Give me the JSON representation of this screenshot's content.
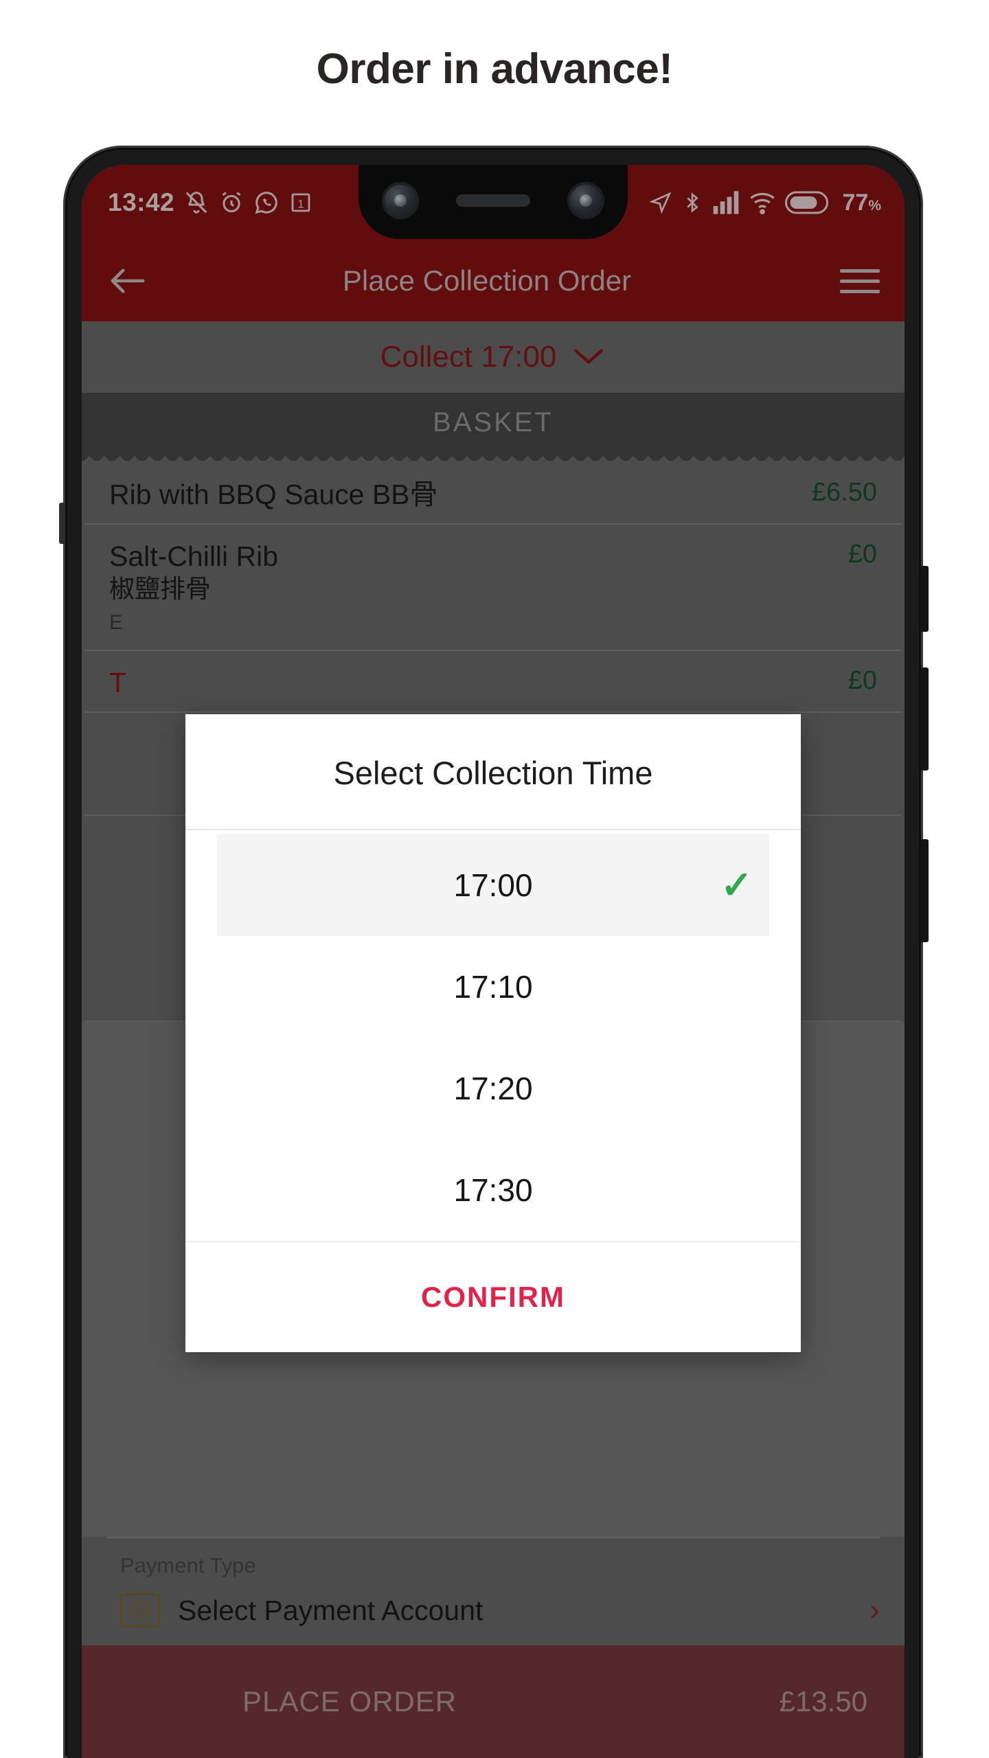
{
  "heading": "Order in advance!",
  "status_bar": {
    "time": "13:42",
    "battery_percent": "77",
    "percent_symbol": "%",
    "left_icons": [
      "bell-off-icon",
      "alarm-icon",
      "whatsapp-icon",
      "calendar-icon"
    ],
    "right_icons": [
      "location-arrow-icon",
      "bluetooth-icon",
      "signal-bars-icon",
      "wifi-icon",
      "battery-icon"
    ]
  },
  "app_bar": {
    "back_icon": "back-arrow-icon",
    "title": "Place Collection Order",
    "menu_icon": "hamburger-menu-icon"
  },
  "collect_bar": {
    "label": "Collect 17:00",
    "chevron": "chevron-down-icon"
  },
  "basket": {
    "header": "BASKET",
    "items": [
      {
        "name": "Rib with BBQ Sauce BB骨",
        "sub": "",
        "options": "",
        "price": "£6.50"
      },
      {
        "name": "Salt-Chilli Rib",
        "sub": "椒鹽排骨",
        "options": "E",
        "price": "£0"
      },
      {
        "name": "T",
        "sub": "",
        "options": "",
        "price": "£0"
      }
    ]
  },
  "payment": {
    "label": "Payment Type",
    "account_text": "Select Payment Account",
    "money_icon": "banknote-icon",
    "money_icon_glyph": "①",
    "chevron": "›"
  },
  "place_order": {
    "label": "PLACE ORDER",
    "total": "£13.50"
  },
  "dialog": {
    "title": "Select Collection Time",
    "options": [
      {
        "time": "17:00",
        "selected": true
      },
      {
        "time": "17:10",
        "selected": false
      },
      {
        "time": "17:20",
        "selected": false
      },
      {
        "time": "17:30",
        "selected": false
      }
    ],
    "check_glyph": "✓",
    "confirm_label": "CONFIRM"
  },
  "colors": {
    "brand_red": "#8c1414",
    "accent_pink": "#e0234a",
    "price_green": "#14532b",
    "check_green": "#34a853"
  }
}
